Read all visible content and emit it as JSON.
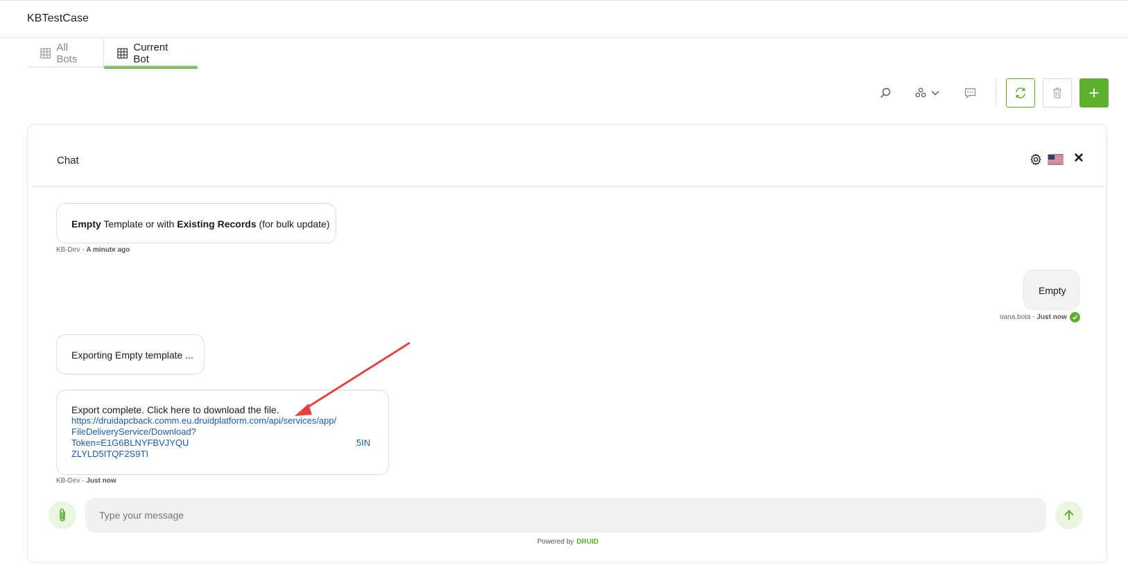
{
  "app": {
    "title": "KBTestCase"
  },
  "tabs": [
    {
      "label": "All Bots",
      "icon": "grid-icon",
      "active": false
    },
    {
      "label": "Current Bot",
      "icon": "grid-icon",
      "active": true
    }
  ],
  "toolbar": {
    "icons": [
      "search-icon",
      "group-icon",
      "chevron-down-icon",
      "chat-icon",
      "refresh-icon",
      "trash-icon",
      "plus-icon"
    ]
  },
  "chat": {
    "title": "Chat",
    "header_icons": [
      "gear-icon",
      "us-flag-icon",
      "close-icon"
    ],
    "close_glyph": "✕",
    "messages": [
      {
        "sender": "bot",
        "parts": {
          "p1": "Empty",
          "p2": " Template or with ",
          "p3": "Existing Records",
          "p4": " (for bulk update)"
        },
        "author": "KB-Dev",
        "separator": " - ",
        "time": "A minute ago"
      },
      {
        "sender": "user",
        "text": "Empty",
        "author": "oana.bota",
        "separator": " - ",
        "time": "Just now",
        "status_icon": "check-circle-icon"
      },
      {
        "sender": "bot",
        "text": "Exporting Empty template ..."
      },
      {
        "sender": "bot",
        "text": "Export complete. Click here to download the file.",
        "link_line1": "https://druidapcback.comm.eu.druidplatform.com/api/services/app/",
        "link_line2": "FileDeliveryService/Download?",
        "link_line3_left": "Token=E1G6BLNYFBVJYQU",
        "link_line3_right": "5IN",
        "link_line4": "ZLYLD5ITQF2S9TI",
        "author": "KB-Dev",
        "separator": " - ",
        "time": "Just now"
      }
    ],
    "input": {
      "placeholder": "Type your message",
      "value": ""
    },
    "powered_by": "Powered by",
    "brand": "DRUID"
  },
  "colors": {
    "accent": "#5cb02e",
    "link": "#1b5bb3",
    "annotation_arrow": "#e8413f"
  }
}
